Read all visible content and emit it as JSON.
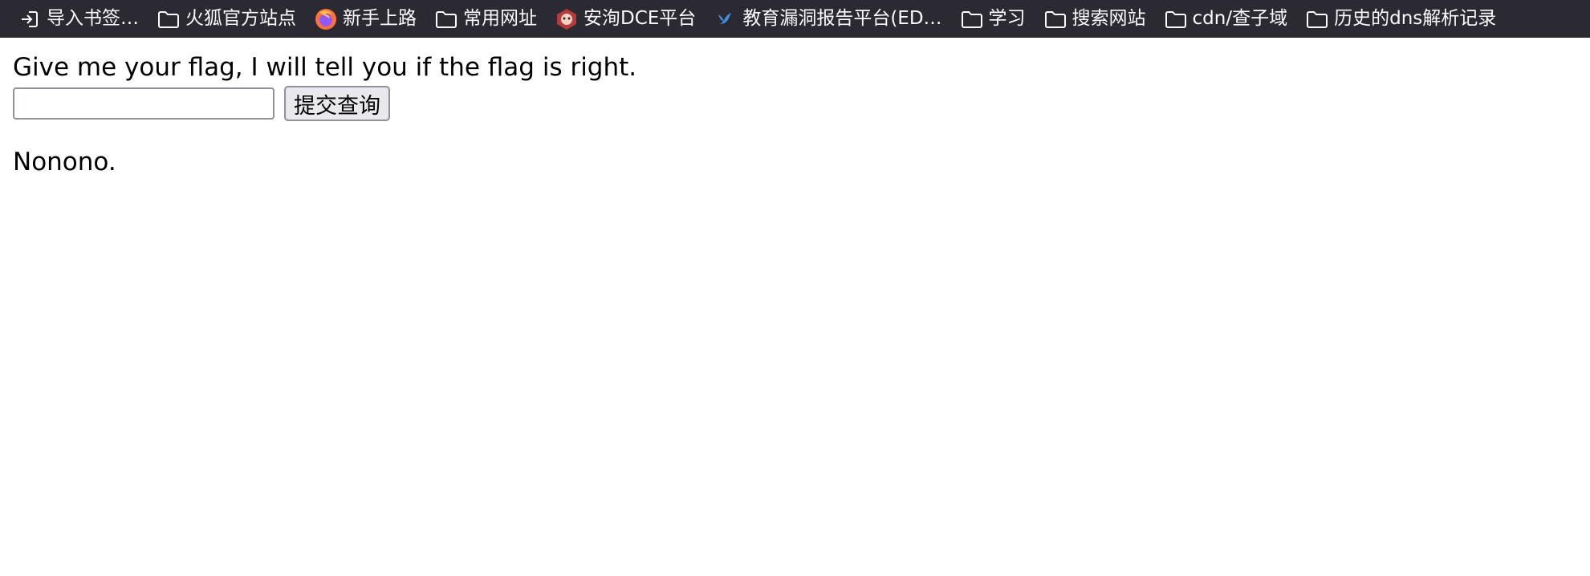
{
  "bookmarks_bar": {
    "items": [
      {
        "label": "导入书签…",
        "icon": "import-icon"
      },
      {
        "label": "火狐官方站点",
        "icon": "folder-icon"
      },
      {
        "label": "新手上路",
        "icon": "firefox-icon"
      },
      {
        "label": "常用网址",
        "icon": "folder-icon"
      },
      {
        "label": "安洵DCE平台",
        "icon": "monkey-icon"
      },
      {
        "label": "教育漏洞报告平台(ED…",
        "icon": "bird-icon"
      },
      {
        "label": "学习",
        "icon": "folder-icon"
      },
      {
        "label": "搜索网站",
        "icon": "folder-icon"
      },
      {
        "label": "cdn/查子域",
        "icon": "folder-icon"
      },
      {
        "label": "历史的dns解析记录",
        "icon": "folder-icon"
      }
    ],
    "colors": {
      "background": "#2b2a33",
      "text": "#fbfbfe"
    }
  },
  "page": {
    "prompt": "Give me your flag, I will tell you if the flag is right.",
    "flag_input_value": "",
    "submit_label": "提交查询",
    "result": "Nonono."
  }
}
